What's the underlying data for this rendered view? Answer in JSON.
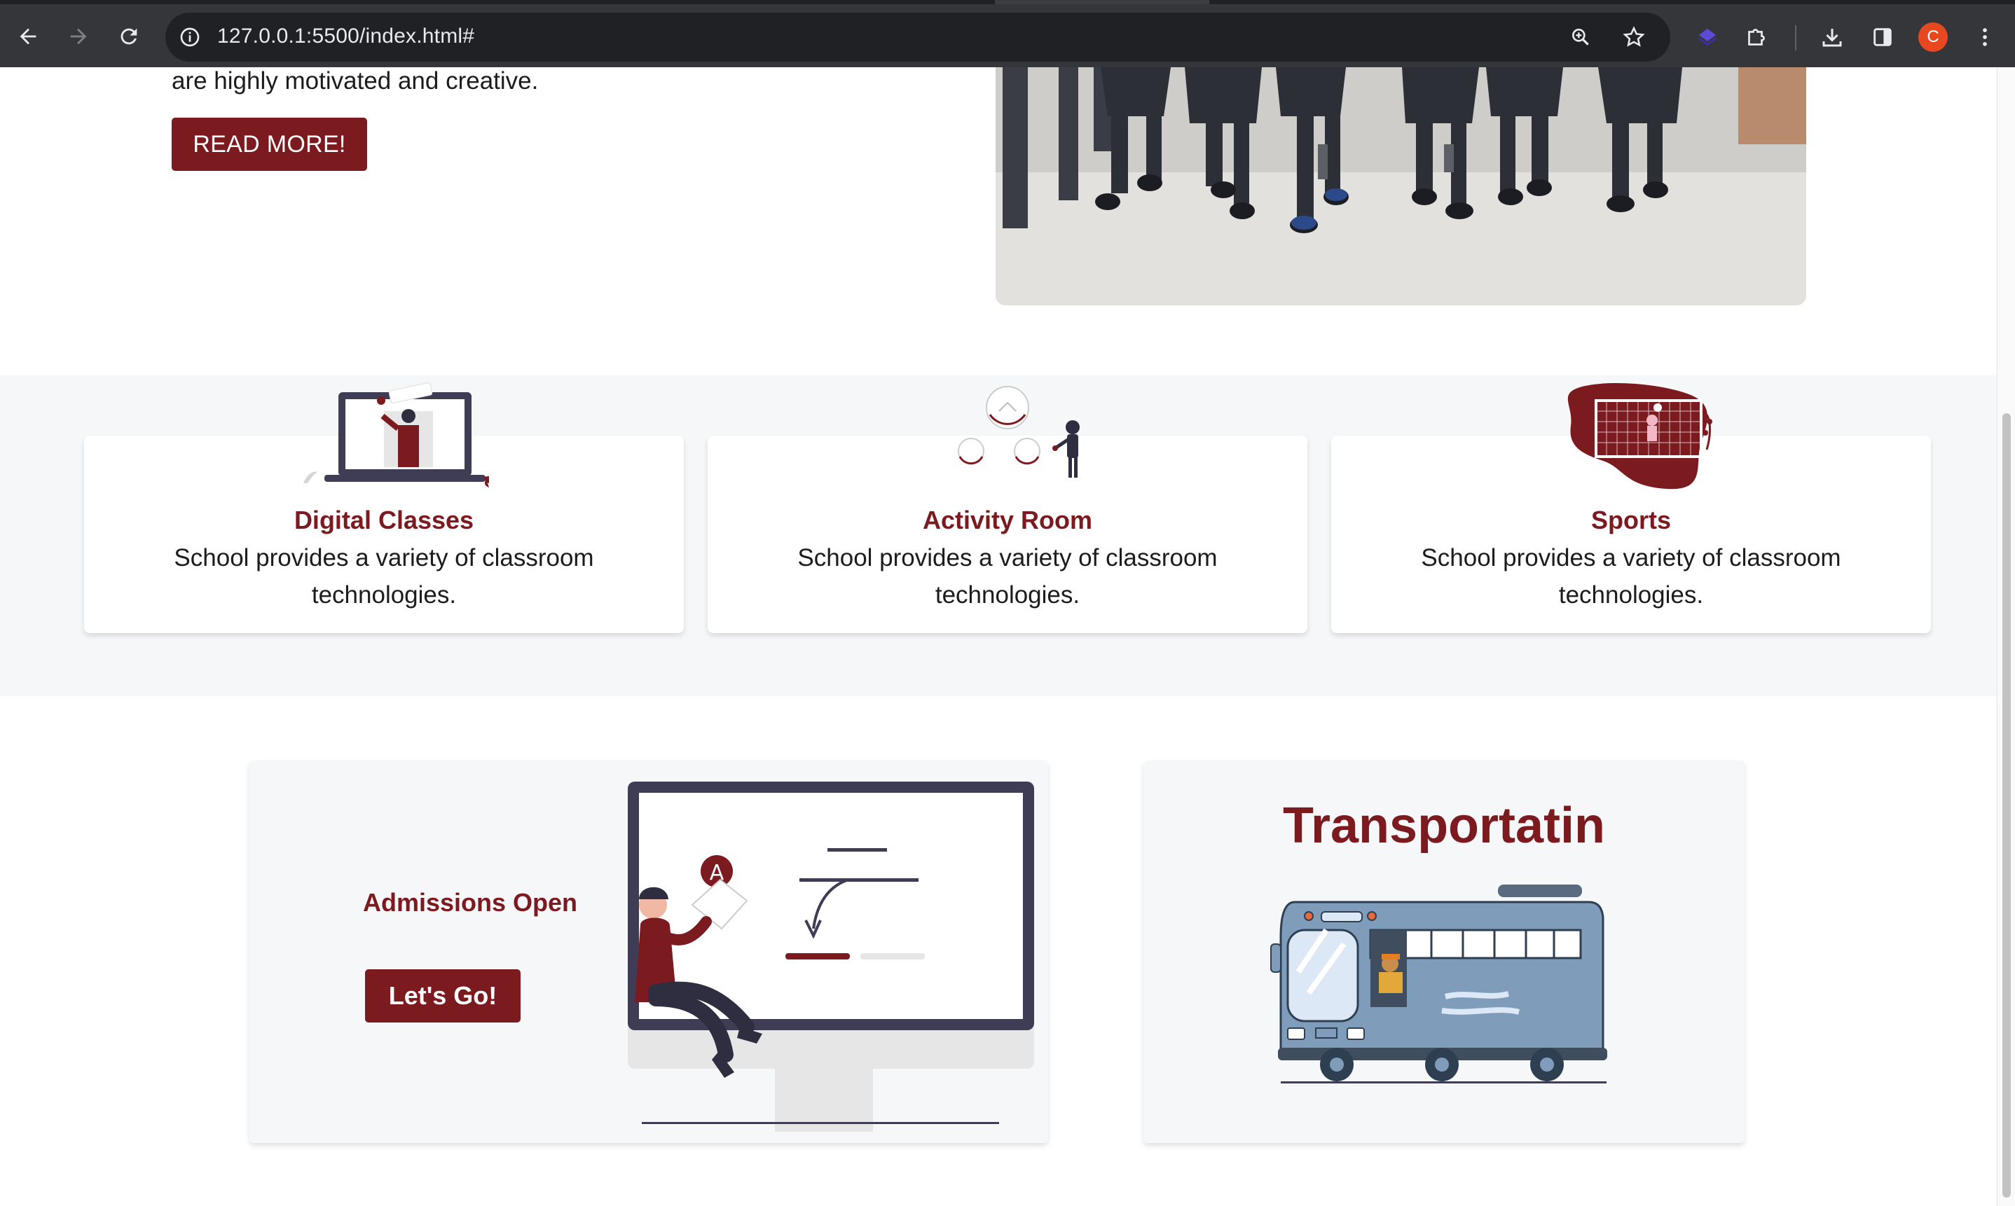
{
  "browser": {
    "url": "127.0.0.1:5500/index.html#",
    "profile_initial": "C",
    "icons": [
      "back-icon",
      "forward-icon",
      "reload-icon",
      "site-info-icon",
      "zoom-icon",
      "bookmark-star-icon",
      "extension-icon",
      "puzzle-icon",
      "download-icon",
      "side-panel-icon",
      "menu-icon"
    ]
  },
  "hero": {
    "text": "are highly motivated and creative.",
    "button_label": "READ MORE!"
  },
  "features": [
    {
      "title": "Digital Classes",
      "description": "School provides a variety of classroom technologies."
    },
    {
      "title": "Activity Room",
      "description": "School provides a variety of classroom technologies."
    },
    {
      "title": "Sports",
      "description": "School provides a variety of classroom technologies."
    }
  ],
  "admissions": {
    "title": "Admissions Open",
    "button_label": "Let's Go!",
    "grade_letter": "A"
  },
  "transport": {
    "title": "Transportatin"
  },
  "colors": {
    "brand": "#7b1b1f",
    "chrome_bg": "#35363a",
    "omnibox_bg": "#202124",
    "section_bg": "#f6f7f9",
    "bus_body": "#7f9dbb"
  }
}
